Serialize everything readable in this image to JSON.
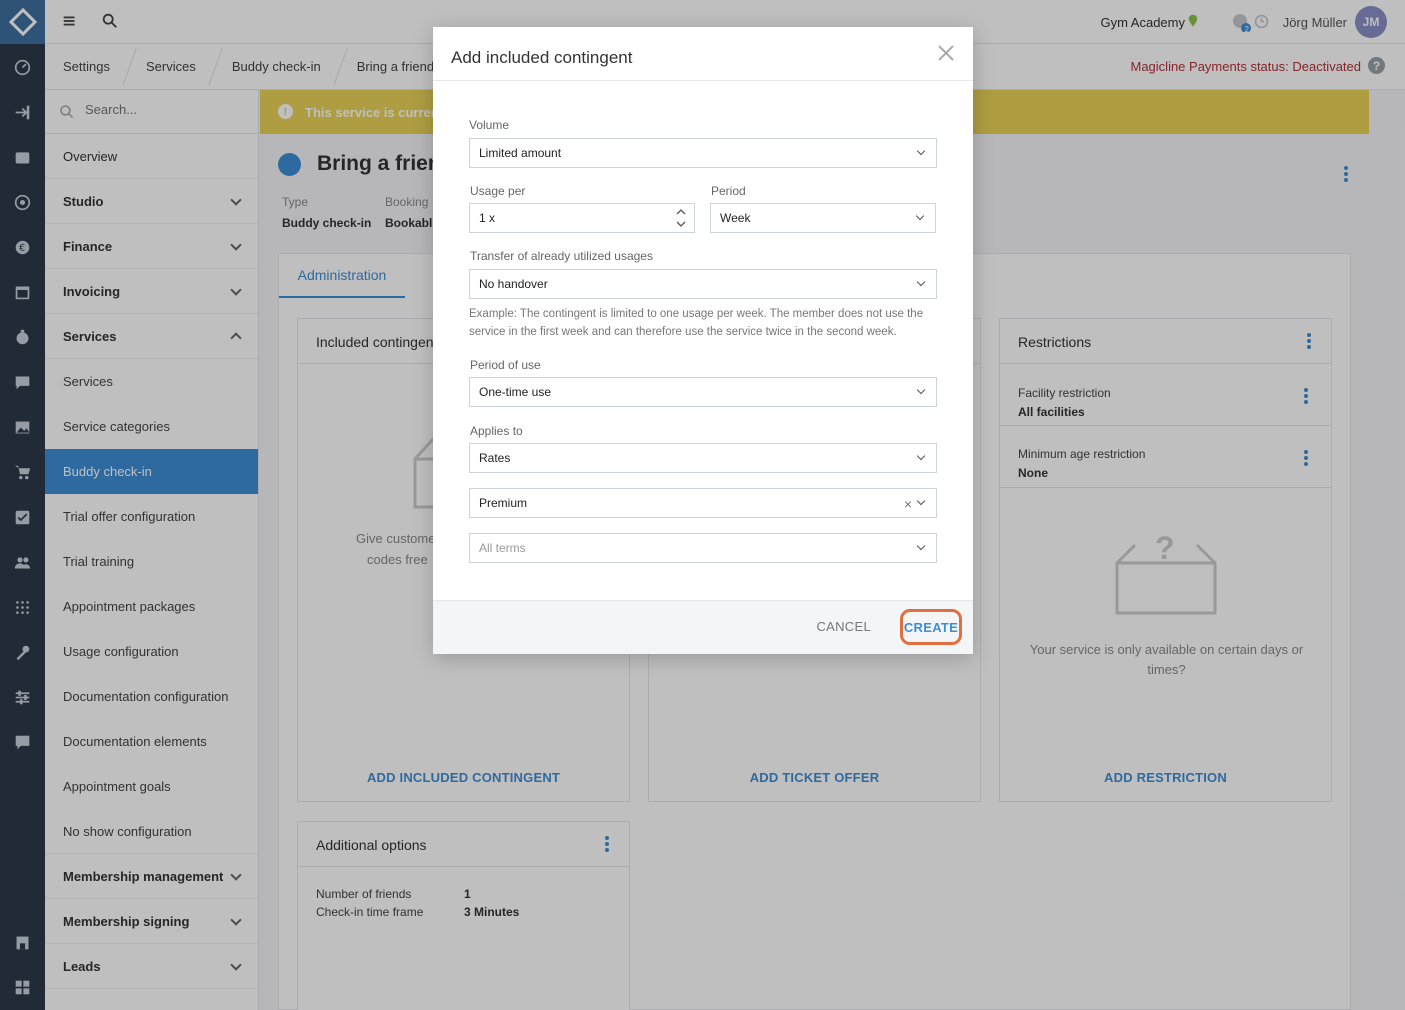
{
  "topbar": {
    "studio": "Gym Academy",
    "user_name": "Jörg Müller",
    "user_initials": "JM",
    "notification_count": "2"
  },
  "breadcrumbs": [
    "Settings",
    "Services",
    "Buddy check-in",
    "Bring a friend"
  ],
  "payment_status": "Magicline Payments status: Deactivated",
  "sidebar": {
    "search_placeholder": "Search...",
    "items": [
      {
        "label": "Overview"
      },
      {
        "label": "Studio"
      },
      {
        "label": "Finance"
      },
      {
        "label": "Invoicing"
      },
      {
        "label": "Services"
      },
      {
        "label": "Services"
      },
      {
        "label": "Service categories"
      },
      {
        "label": "Buddy check-in"
      },
      {
        "label": "Trial offer configuration"
      },
      {
        "label": "Trial training"
      },
      {
        "label": "Appointment packages"
      },
      {
        "label": "Usage configuration"
      },
      {
        "label": "Documentation configuration"
      },
      {
        "label": "Documentation elements"
      },
      {
        "label": "Appointment goals"
      },
      {
        "label": "No show configuration"
      },
      {
        "label": "Membership management"
      },
      {
        "label": "Membership signing"
      },
      {
        "label": "Leads"
      }
    ]
  },
  "main": {
    "banner": "This service is currenti",
    "title": "Bring a frien",
    "meta": {
      "type_label": "Type",
      "type_value": "Buddy check-in",
      "booking_label": "Booking",
      "booking_value": "Bookabl"
    },
    "tab_label": "Administration",
    "cards": {
      "included": {
        "title": "Included contingen",
        "body": "Give custome",
        "body2": "codes free",
        "action": "ADD INCLUDED CONTINGENT"
      },
      "tickets": {
        "action": "ADD TICKET OFFER"
      },
      "restrictions": {
        "title": "Restrictions",
        "facility_label": "Facility restriction",
        "facility_value": "All facilities",
        "age_label": "Minimum age restriction",
        "age_value": "None",
        "body": "Your service is only available on certain days or times?",
        "action": "ADD RESTRICTION"
      },
      "additional": {
        "title": "Additional options",
        "friends_label": "Number of friends",
        "friends_value": "1",
        "timeframe_label": "Check-in time frame",
        "timeframe_value": "3 Minutes"
      }
    }
  },
  "modal": {
    "title": "Add included contingent",
    "volume_label": "Volume",
    "volume_value": "Limited amount",
    "usage_label": "Usage per",
    "usage_value": "1  x",
    "period_label": "Period",
    "period_value": "Week",
    "transfer_label": "Transfer of already utilized usages",
    "transfer_value": "No handover",
    "hint": "Example: The contingent is limited to one usage per week. The member does not use the service in the first week and can therefore use the service twice in the second week.",
    "period_use_label": "Period of use",
    "period_use_value": "One-time use",
    "applies_label": "Applies to",
    "applies_value": "Rates",
    "rate_value": "Premium",
    "terms_placeholder": "All terms",
    "cancel": "CANCEL",
    "create": "CREATE"
  },
  "colors": {
    "accent": "#3e8ed6",
    "banner": "#e8d257",
    "rail": "#2d3a4a",
    "highlight": "#e0703f",
    "status_error": "#b0323a"
  }
}
